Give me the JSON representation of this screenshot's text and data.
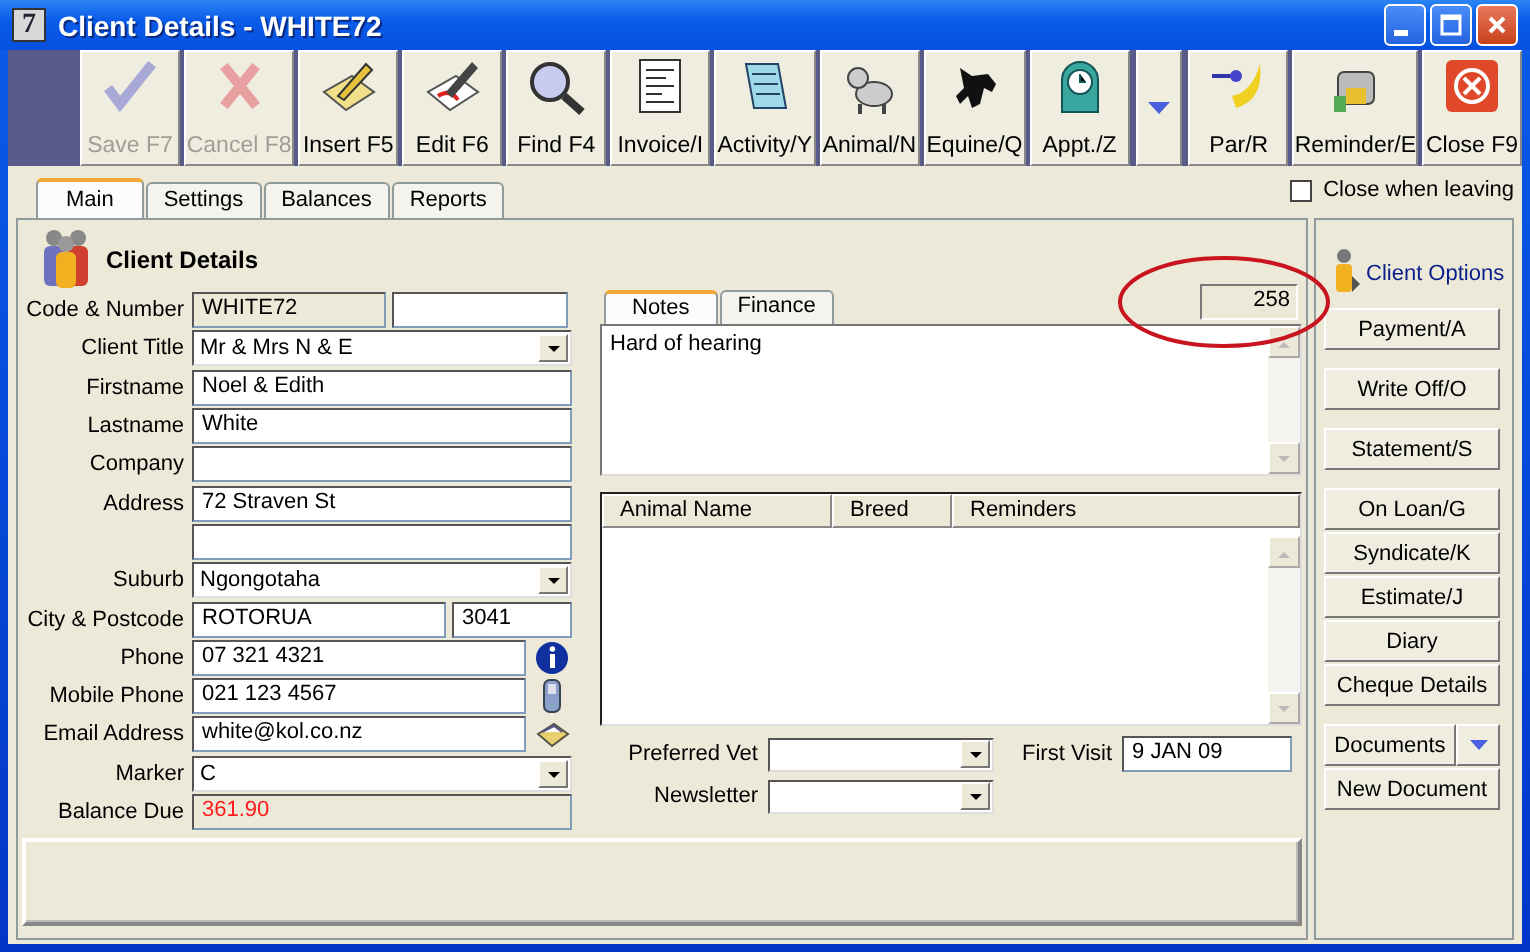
{
  "window": {
    "title": "Client Details - WHITE72",
    "app_icon": "7"
  },
  "toolbar": [
    {
      "kind": "button",
      "label": "Save F7",
      "disabled": true
    },
    {
      "kind": "button",
      "label": "Cancel F8",
      "disabled": true
    },
    {
      "kind": "button",
      "label": "Insert F5",
      "disabled": false
    },
    {
      "kind": "button",
      "label": "Edit F6",
      "disabled": false
    },
    {
      "kind": "button",
      "label": "Find F4",
      "disabled": false
    },
    {
      "kind": "button",
      "label": "Invoice/I",
      "disabled": false
    },
    {
      "kind": "button",
      "label": "Activity/Y",
      "disabled": false
    },
    {
      "kind": "button",
      "label": "Animal/N",
      "disabled": false
    },
    {
      "kind": "button",
      "label": "Equine/Q",
      "disabled": false
    },
    {
      "kind": "button",
      "label": "Appt./Z",
      "disabled": false
    },
    {
      "kind": "arrow"
    },
    {
      "kind": "button",
      "label": "Par/R",
      "disabled": false
    },
    {
      "kind": "button",
      "label": "Reminder/E",
      "disabled": false
    },
    {
      "kind": "button",
      "label": "Close F9",
      "disabled": false
    }
  ],
  "tabs": [
    {
      "label": "Main",
      "selected": true
    },
    {
      "label": "Settings",
      "selected": false
    },
    {
      "label": "Balances",
      "selected": false
    },
    {
      "label": "Reports",
      "selected": false
    }
  ],
  "close_when_leaving": {
    "label": "Close when leaving",
    "checked": false
  },
  "client_details": {
    "heading": "Client Details",
    "fields": [
      {
        "kind": "code",
        "label": "Code & Number",
        "value": "WHITE72"
      },
      {
        "kind": "combo",
        "label": "Client Title",
        "value": "Mr & Mrs N & E"
      },
      {
        "kind": "text",
        "label": "Firstname",
        "value": "Noel & Edith"
      },
      {
        "kind": "text",
        "label": "Lastname",
        "value": "White"
      },
      {
        "kind": "text",
        "label": "Company"
      },
      {
        "kind": "text",
        "label": "Address",
        "value": "72 Straven St"
      },
      {
        "kind": "text"
      },
      {
        "kind": "combo",
        "label": "Suburb",
        "value": "Ngongotaha"
      },
      {
        "kind": "city",
        "label": "City & Postcode",
        "value": "ROTORUA",
        "value2": "3041"
      },
      {
        "kind": "action",
        "label": "Phone",
        "value": "07 321 4321"
      },
      {
        "kind": "action",
        "label": "Mobile Phone",
        "value": "021 123 4567"
      },
      {
        "kind": "action",
        "label": "Email Address",
        "value": "white@kol.co.nz"
      },
      {
        "kind": "combo",
        "label": "Marker",
        "value": "C"
      },
      {
        "kind": "amount",
        "label": "Balance Due",
        "value": "361.90"
      }
    ]
  },
  "notes": {
    "tabs": [
      {
        "label": "Notes",
        "selected": true
      },
      {
        "label": "Finance",
        "selected": false
      }
    ],
    "counter": "258",
    "text": "Hard of hearing"
  },
  "animals": {
    "columns": [
      "Animal Name",
      "Breed",
      "Reminders"
    ]
  },
  "preferred_vet": {
    "label": "Preferred Vet"
  },
  "newsletter": {
    "label": "Newsletter"
  },
  "first_visit": {
    "label": "First Visit",
    "value": "9 JAN 09"
  },
  "client_options": {
    "title": "Client Options",
    "groups": [
      [
        {
          "kind": "button",
          "label": "Payment/A"
        }
      ],
      [
        {
          "kind": "button",
          "label": "Write Off/O"
        }
      ],
      [
        {
          "kind": "button",
          "label": "Statement/S"
        }
      ],
      [
        {
          "kind": "button",
          "label": "On Loan/G"
        },
        {
          "kind": "button",
          "label": "Syndicate/K"
        },
        {
          "kind": "button",
          "label": "Estimate/J"
        },
        {
          "kind": "button",
          "label": "Diary"
        },
        {
          "kind": "button",
          "label": "Cheque Details"
        }
      ],
      [
        {
          "kind": "split",
          "label": "Documents"
        },
        {
          "kind": "button",
          "label": "New Document"
        }
      ]
    ]
  }
}
